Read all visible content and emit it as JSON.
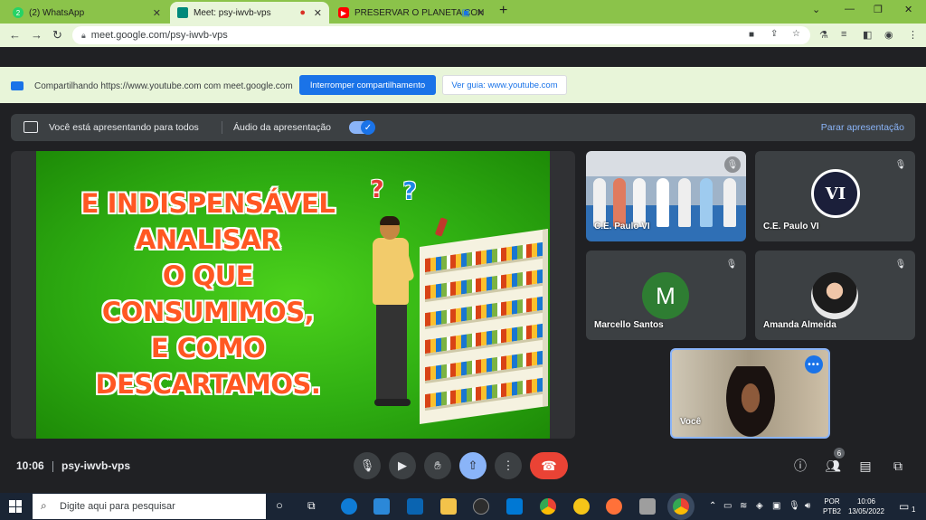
{
  "browser": {
    "tabs": [
      {
        "label": "(2) WhatsApp",
        "color": "#25d366",
        "glyph": "2"
      },
      {
        "label": "Meet: psy-iwvb-vps",
        "color": "#00897b",
        "glyph": ""
      },
      {
        "label": "PRESERVAR O PLANETA CON",
        "color": "#ff0000",
        "glyph": "▶"
      }
    ],
    "url": "meet.google.com/psy-iwvb-vps"
  },
  "sharebar": {
    "text": "Compartilhando https://www.youtube.com com meet.google.com",
    "stop_label": "Interromper compartilhamento",
    "view_label": "Ver guia: www.youtube.com"
  },
  "presenting": {
    "text": "Você está apresentando para todos",
    "audio_label": "Áudio da apresentação",
    "stop_label": "Parar apresentação"
  },
  "slide": {
    "lines": [
      "E INDISPENSÁVEL",
      "ANALISAR",
      "O QUE",
      "CONSUMIMOS,",
      "E COMO",
      "DESCARTAMOS."
    ]
  },
  "participants": [
    {
      "name": "C.E. Paulo VI"
    },
    {
      "name": "C.E. Paulo VI",
      "logo_text": "VI"
    },
    {
      "name": "Marcello Santos",
      "initial": "M"
    },
    {
      "name": "Amanda Almeida"
    },
    {
      "name": "Você"
    }
  ],
  "meeting": {
    "time": "10:06",
    "code": "psy-iwvb-vps",
    "people_count": "6"
  },
  "taskbar": {
    "search_placeholder": "Digite aqui para pesquisar",
    "lang": "POR",
    "layout": "PTB2",
    "time": "10:06",
    "date": "13/05/2022",
    "notif_count": "1"
  }
}
